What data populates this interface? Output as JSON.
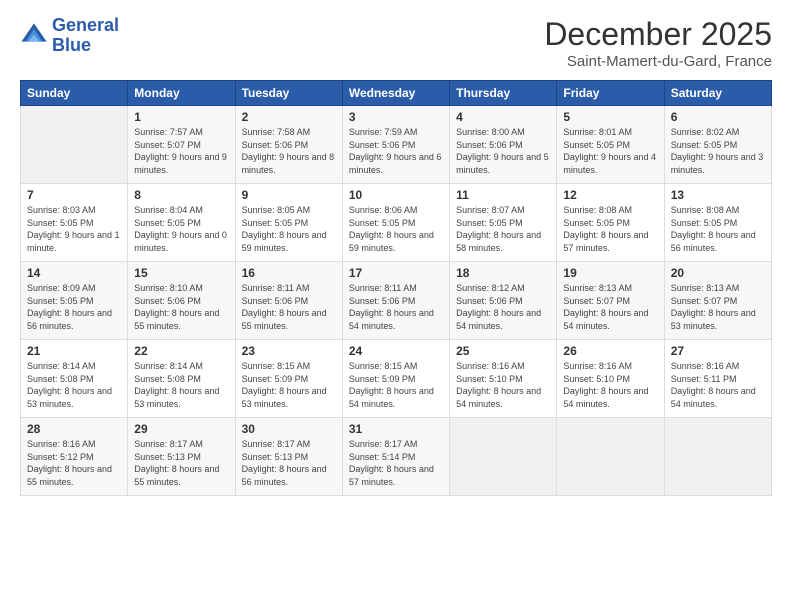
{
  "header": {
    "logo_line1": "General",
    "logo_line2": "Blue",
    "month_title": "December 2025",
    "location": "Saint-Mamert-du-Gard, France"
  },
  "days_of_week": [
    "Sunday",
    "Monday",
    "Tuesday",
    "Wednesday",
    "Thursday",
    "Friday",
    "Saturday"
  ],
  "weeks": [
    [
      {
        "day": "",
        "sunrise": "",
        "sunset": "",
        "daylight": ""
      },
      {
        "day": "1",
        "sunrise": "Sunrise: 7:57 AM",
        "sunset": "Sunset: 5:07 PM",
        "daylight": "Daylight: 9 hours and 9 minutes."
      },
      {
        "day": "2",
        "sunrise": "Sunrise: 7:58 AM",
        "sunset": "Sunset: 5:06 PM",
        "daylight": "Daylight: 9 hours and 8 minutes."
      },
      {
        "day": "3",
        "sunrise": "Sunrise: 7:59 AM",
        "sunset": "Sunset: 5:06 PM",
        "daylight": "Daylight: 9 hours and 6 minutes."
      },
      {
        "day": "4",
        "sunrise": "Sunrise: 8:00 AM",
        "sunset": "Sunset: 5:06 PM",
        "daylight": "Daylight: 9 hours and 5 minutes."
      },
      {
        "day": "5",
        "sunrise": "Sunrise: 8:01 AM",
        "sunset": "Sunset: 5:05 PM",
        "daylight": "Daylight: 9 hours and 4 minutes."
      },
      {
        "day": "6",
        "sunrise": "Sunrise: 8:02 AM",
        "sunset": "Sunset: 5:05 PM",
        "daylight": "Daylight: 9 hours and 3 minutes."
      }
    ],
    [
      {
        "day": "7",
        "sunrise": "Sunrise: 8:03 AM",
        "sunset": "Sunset: 5:05 PM",
        "daylight": "Daylight: 9 hours and 1 minute."
      },
      {
        "day": "8",
        "sunrise": "Sunrise: 8:04 AM",
        "sunset": "Sunset: 5:05 PM",
        "daylight": "Daylight: 9 hours and 0 minutes."
      },
      {
        "day": "9",
        "sunrise": "Sunrise: 8:05 AM",
        "sunset": "Sunset: 5:05 PM",
        "daylight": "Daylight: 8 hours and 59 minutes."
      },
      {
        "day": "10",
        "sunrise": "Sunrise: 8:06 AM",
        "sunset": "Sunset: 5:05 PM",
        "daylight": "Daylight: 8 hours and 59 minutes."
      },
      {
        "day": "11",
        "sunrise": "Sunrise: 8:07 AM",
        "sunset": "Sunset: 5:05 PM",
        "daylight": "Daylight: 8 hours and 58 minutes."
      },
      {
        "day": "12",
        "sunrise": "Sunrise: 8:08 AM",
        "sunset": "Sunset: 5:05 PM",
        "daylight": "Daylight: 8 hours and 57 minutes."
      },
      {
        "day": "13",
        "sunrise": "Sunrise: 8:08 AM",
        "sunset": "Sunset: 5:05 PM",
        "daylight": "Daylight: 8 hours and 56 minutes."
      }
    ],
    [
      {
        "day": "14",
        "sunrise": "Sunrise: 8:09 AM",
        "sunset": "Sunset: 5:05 PM",
        "daylight": "Daylight: 8 hours and 56 minutes."
      },
      {
        "day": "15",
        "sunrise": "Sunrise: 8:10 AM",
        "sunset": "Sunset: 5:06 PM",
        "daylight": "Daylight: 8 hours and 55 minutes."
      },
      {
        "day": "16",
        "sunrise": "Sunrise: 8:11 AM",
        "sunset": "Sunset: 5:06 PM",
        "daylight": "Daylight: 8 hours and 55 minutes."
      },
      {
        "day": "17",
        "sunrise": "Sunrise: 8:11 AM",
        "sunset": "Sunset: 5:06 PM",
        "daylight": "Daylight: 8 hours and 54 minutes."
      },
      {
        "day": "18",
        "sunrise": "Sunrise: 8:12 AM",
        "sunset": "Sunset: 5:06 PM",
        "daylight": "Daylight: 8 hours and 54 minutes."
      },
      {
        "day": "19",
        "sunrise": "Sunrise: 8:13 AM",
        "sunset": "Sunset: 5:07 PM",
        "daylight": "Daylight: 8 hours and 54 minutes."
      },
      {
        "day": "20",
        "sunrise": "Sunrise: 8:13 AM",
        "sunset": "Sunset: 5:07 PM",
        "daylight": "Daylight: 8 hours and 53 minutes."
      }
    ],
    [
      {
        "day": "21",
        "sunrise": "Sunrise: 8:14 AM",
        "sunset": "Sunset: 5:08 PM",
        "daylight": "Daylight: 8 hours and 53 minutes."
      },
      {
        "day": "22",
        "sunrise": "Sunrise: 8:14 AM",
        "sunset": "Sunset: 5:08 PM",
        "daylight": "Daylight: 8 hours and 53 minutes."
      },
      {
        "day": "23",
        "sunrise": "Sunrise: 8:15 AM",
        "sunset": "Sunset: 5:09 PM",
        "daylight": "Daylight: 8 hours and 53 minutes."
      },
      {
        "day": "24",
        "sunrise": "Sunrise: 8:15 AM",
        "sunset": "Sunset: 5:09 PM",
        "daylight": "Daylight: 8 hours and 54 minutes."
      },
      {
        "day": "25",
        "sunrise": "Sunrise: 8:16 AM",
        "sunset": "Sunset: 5:10 PM",
        "daylight": "Daylight: 8 hours and 54 minutes."
      },
      {
        "day": "26",
        "sunrise": "Sunrise: 8:16 AM",
        "sunset": "Sunset: 5:10 PM",
        "daylight": "Daylight: 8 hours and 54 minutes."
      },
      {
        "day": "27",
        "sunrise": "Sunrise: 8:16 AM",
        "sunset": "Sunset: 5:11 PM",
        "daylight": "Daylight: 8 hours and 54 minutes."
      }
    ],
    [
      {
        "day": "28",
        "sunrise": "Sunrise: 8:16 AM",
        "sunset": "Sunset: 5:12 PM",
        "daylight": "Daylight: 8 hours and 55 minutes."
      },
      {
        "day": "29",
        "sunrise": "Sunrise: 8:17 AM",
        "sunset": "Sunset: 5:13 PM",
        "daylight": "Daylight: 8 hours and 55 minutes."
      },
      {
        "day": "30",
        "sunrise": "Sunrise: 8:17 AM",
        "sunset": "Sunset: 5:13 PM",
        "daylight": "Daylight: 8 hours and 56 minutes."
      },
      {
        "day": "31",
        "sunrise": "Sunrise: 8:17 AM",
        "sunset": "Sunset: 5:14 PM",
        "daylight": "Daylight: 8 hours and 57 minutes."
      },
      {
        "day": "",
        "sunrise": "",
        "sunset": "",
        "daylight": ""
      },
      {
        "day": "",
        "sunrise": "",
        "sunset": "",
        "daylight": ""
      },
      {
        "day": "",
        "sunrise": "",
        "sunset": "",
        "daylight": ""
      }
    ]
  ]
}
